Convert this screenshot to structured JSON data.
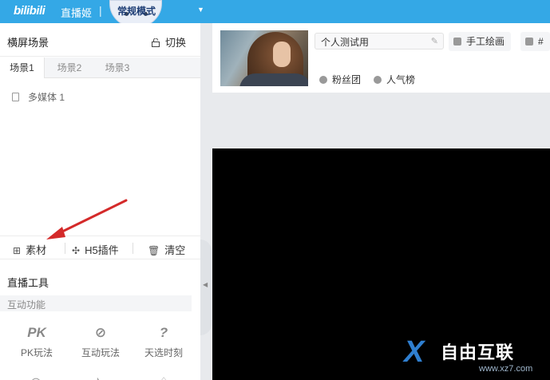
{
  "topbar": {
    "logo": "bilibili",
    "app_name": "直播姬",
    "separator": "|",
    "mode": "常规模式",
    "mode_caret": "▼"
  },
  "scene_panel": {
    "title": "横屏场景",
    "switch_label": "切换",
    "tabs": [
      {
        "label": "场景1",
        "active": true
      },
      {
        "label": "场景2",
        "active": false
      },
      {
        "label": "场景3",
        "active": false
      }
    ],
    "sources": [
      "多媒体 1"
    ]
  },
  "toolbar": {
    "material_label": "素材",
    "h5_label": "H5插件",
    "clear_label": "清空"
  },
  "live_tools": {
    "title": "直播工具",
    "interact_label": "互动功能",
    "items": [
      {
        "label": "PK玩法",
        "icon": "pk-icon",
        "glyph": "PK"
      },
      {
        "label": "互动玩法",
        "icon": "interactive-icon",
        "glyph": "⊘"
      },
      {
        "label": "天选时刻",
        "icon": "lucky-icon",
        "glyph": "?"
      }
    ]
  },
  "room": {
    "title_value": "个人测试用",
    "category": "手工绘画",
    "tag_partial": "#",
    "fan_club": "粉丝团",
    "popularity": "人气榜"
  },
  "watermark": {
    "brand": "自由互联",
    "url": "www.xz7.com",
    "mark": "X"
  },
  "colors": {
    "topbar": "#34a8e6",
    "annotation_arrow": "#d42a2a",
    "preview_bg": "#000000"
  }
}
